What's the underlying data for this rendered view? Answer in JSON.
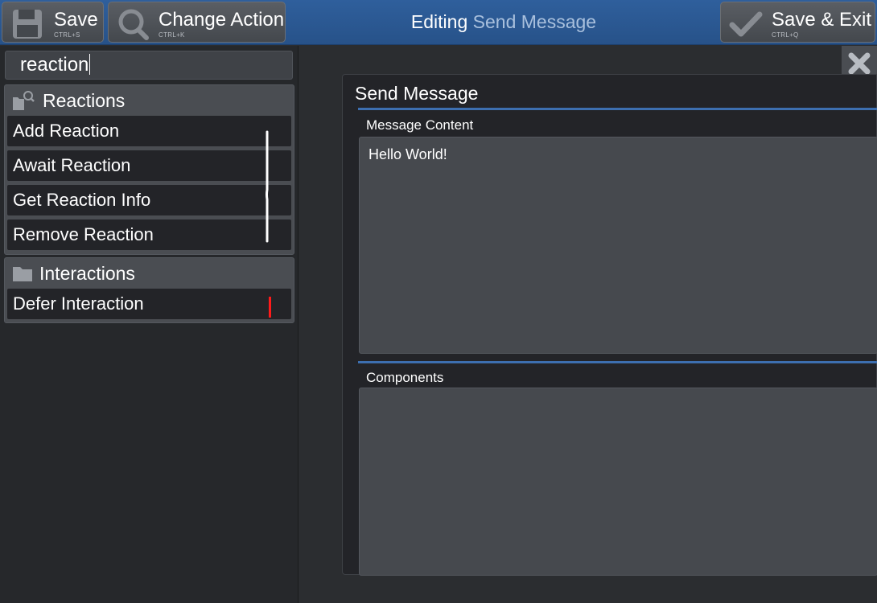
{
  "toolbar": {
    "save_label": "Save",
    "save_shortcut": "CTRL+S",
    "change_label": "Change Action",
    "change_shortcut": "CTRL+K",
    "exit_label": "Save & Exit",
    "exit_shortcut": "CTRL+Q",
    "title_prefix": "Editing",
    "title_action": "Send Message"
  },
  "search": {
    "value": "reaction"
  },
  "groups": [
    {
      "title": "Reactions",
      "icon": "folder-search-icon",
      "items": [
        "Add Reaction",
        "Await Reaction",
        "Get Reaction Info",
        "Remove Reaction"
      ]
    },
    {
      "title": "Interactions",
      "icon": "folder-icon",
      "items": [
        "Defer Interaction"
      ]
    }
  ],
  "editor": {
    "title": "Send Message",
    "fields": [
      {
        "label": "Message Content",
        "value": "Hello World!"
      },
      {
        "label": "Components",
        "value": ""
      }
    ]
  },
  "colors": {
    "topbar": "#275289",
    "accent": "#3d6fb0",
    "panel": "#26282b",
    "annotation_red": "#ff1a1a"
  }
}
